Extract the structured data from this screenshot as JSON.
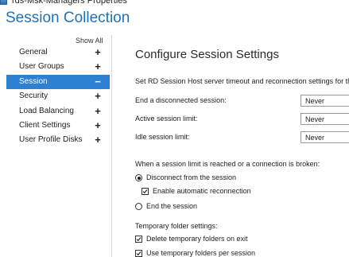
{
  "window": {
    "title": "rds-Msk-Managers Properties",
    "icon": "properties-window-icon"
  },
  "page_title": "Session Collection",
  "sidebar": {
    "show_all": "Show All",
    "items": [
      {
        "label": "General",
        "sign": "+",
        "active": false
      },
      {
        "label": "User Groups",
        "sign": "+",
        "active": false
      },
      {
        "label": "Session",
        "sign": "−",
        "active": true
      },
      {
        "label": "Security",
        "sign": "+",
        "active": false
      },
      {
        "label": "Load Balancing",
        "sign": "+",
        "active": false
      },
      {
        "label": "Client Settings",
        "sign": "+",
        "active": false
      },
      {
        "label": "User Profile Disks",
        "sign": "+",
        "active": false
      }
    ]
  },
  "main": {
    "heading": "Configure Session Settings",
    "description": "Set RD Session Host server timeout and reconnection settings for th",
    "timeouts": [
      {
        "label": "End a disconnected session:",
        "value": "Never"
      },
      {
        "label": "Active session limit:",
        "value": "Never"
      },
      {
        "label": "Idle session limit:",
        "value": "Never"
      }
    ],
    "limit_prompt": "When a session limit is reached or a connection is broken:",
    "disconnect_option": "Disconnect from the session",
    "auto_reconnect": "Enable automatic reconnection",
    "end_option": "End the session",
    "temp_heading": "Temporary folder settings:",
    "delete_temp": "Delete temporary folders on exit",
    "use_temp": "Use temporary folders per session"
  },
  "colors": {
    "accent": "#2072b8",
    "selection": "#2e80d2"
  }
}
